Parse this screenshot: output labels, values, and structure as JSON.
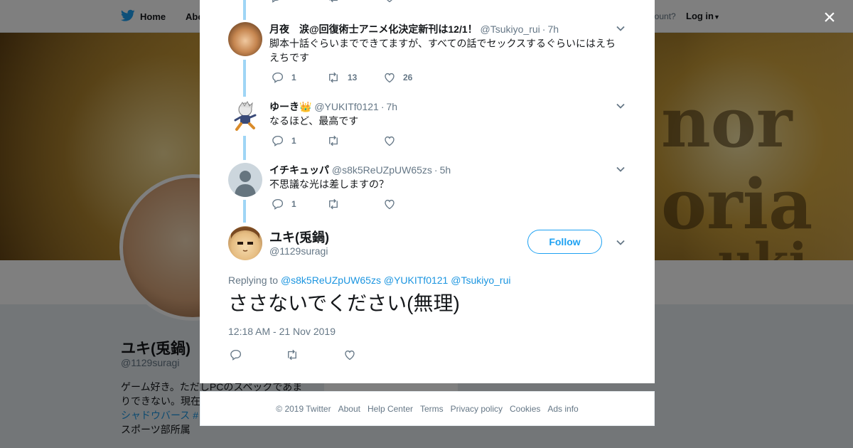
{
  "background": {
    "nav": {
      "home_label": "Home",
      "about_label": "Abo",
      "have_account": "account?",
      "login_label": "Log in"
    },
    "banner_text": [
      "nor",
      "oria",
      "uki"
    ],
    "profile": {
      "name": "ユキ(兎鍋)",
      "handle": "@1129suragi",
      "bio_line1": "ゲーム好き。ただしPCのスペックであま",
      "bio_line2": "りできない。現在",
      "bio_link": "シャドウバース #",
      "bio_line3": "スポーツ部所属"
    },
    "ads_fragment": "Ads info"
  },
  "modal": {
    "close_label": "×",
    "context_tweets": [
      {
        "name": "月夜　涙@回復術士アニメ化決定新刊は12/1！",
        "handle": "@Tsukiyo_rui",
        "time": "7h",
        "text": "脚本十話ぐらいまでできてますが、すべての話でセックスするぐらいにはえちえちです",
        "replies": "1",
        "retweets": "13",
        "likes": "26"
      },
      {
        "name": "ゆーき",
        "handle": "@YUKITf0121",
        "time": "7h",
        "text": "なるほど、最高です",
        "replies": "1",
        "retweets": "",
        "likes": ""
      },
      {
        "name": "イチキュッパ",
        "handle": "@s8k5ReUZpUW65zs",
        "time": "5h",
        "text": "不思議な光は差しますの？",
        "replies": "1",
        "retweets": "",
        "likes": ""
      }
    ],
    "main_tweet": {
      "name": "ユキ(兎鍋)",
      "handle": "@1129suragi",
      "follow_label": "Follow",
      "replying_label": "Replying to",
      "mentions": [
        "@s8k5ReUZpUW65zs",
        "@YUKITf0121",
        "@Tsukiyo_rui"
      ],
      "text": "ささないでください(無理)",
      "timestamp": "12:18 AM - 21 Nov 2019"
    }
  },
  "footer": {
    "copyright": "© 2019 Twitter",
    "links": [
      "About",
      "Help Center",
      "Terms",
      "Privacy policy",
      "Cookies",
      "Ads info"
    ]
  },
  "colors": {
    "accent": "#1da1f2",
    "link": "#1b95e0",
    "muted": "#657786",
    "reply_line": "#9fd5f5"
  }
}
